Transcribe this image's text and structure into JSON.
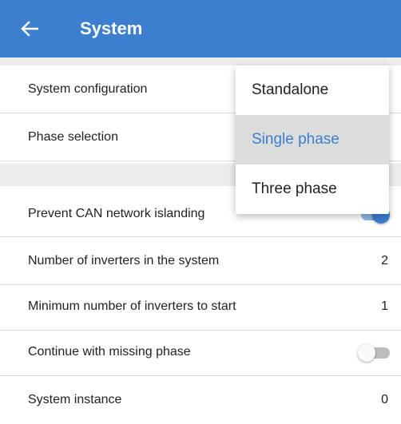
{
  "header": {
    "title": "System",
    "back_icon": "arrow-left-icon"
  },
  "colors": {
    "accent": "#3b7fce",
    "divider": "#dcdcdc",
    "section_bg": "#ececec"
  },
  "settings": {
    "system_configuration": {
      "label": "System configuration"
    },
    "phase_selection": {
      "label": "Phase selection"
    },
    "prevent_can_islanding": {
      "label": "Prevent CAN network islanding",
      "enabled": true
    },
    "num_inverters": {
      "label": "Number of inverters in the system",
      "value": "2"
    },
    "min_inverters": {
      "label": "Minimum number of inverters to start",
      "value": "1"
    },
    "continue_missing_phase": {
      "label": "Continue with missing phase",
      "enabled": false
    },
    "system_instance": {
      "label": "System instance",
      "value": "0"
    }
  },
  "dropdown": {
    "options": [
      {
        "label": "Standalone",
        "selected": false
      },
      {
        "label": "Single phase",
        "selected": true
      },
      {
        "label": "Three phase",
        "selected": false
      }
    ]
  }
}
